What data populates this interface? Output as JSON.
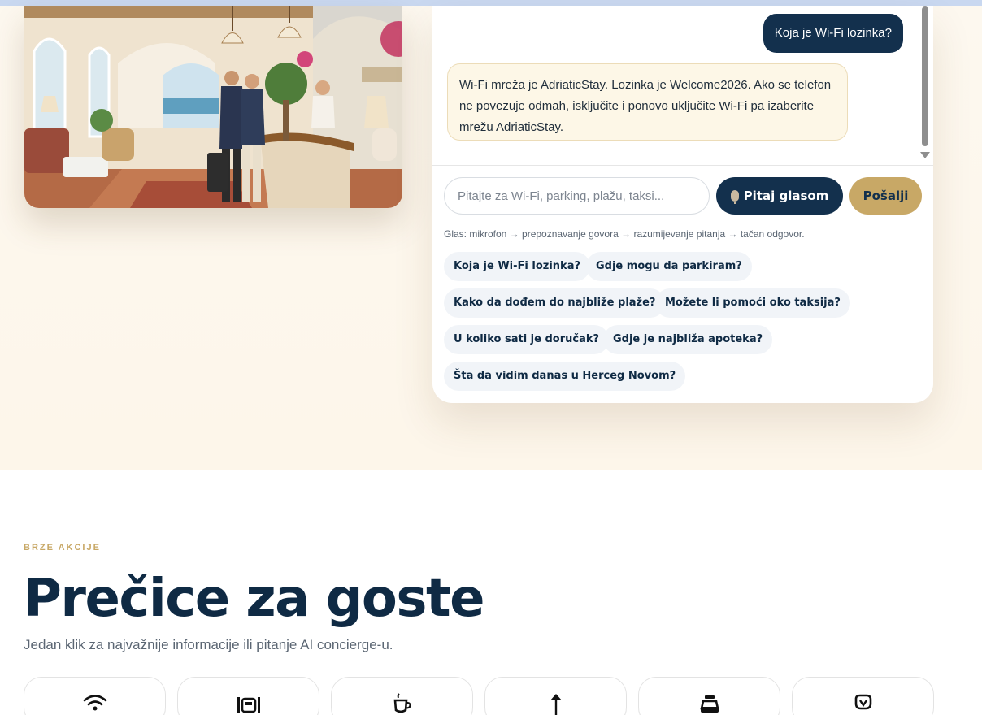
{
  "chat": {
    "user_message": "Koja je Wi-Fi lozinka?",
    "bot_message": "Wi-Fi mreža je AdriaticStay. Lozinka je Welcome2026. Ako se telefon ne povezuje odmah, isključite i ponovo uključite Wi-Fi pa izaberite mrežu AdriaticStay.",
    "input_placeholder": "Pitajte za Wi-Fi, parking, plažu, taksi...",
    "voice_button_label": "Pitaj glasom",
    "send_button_label": "Pošalji",
    "voice_hint": "Glas: mikrofon → prepoznavanje govora → razumijevanje pitanja → tačan odgovor.",
    "suggestions": [
      "Koja je Wi-Fi lozinka?",
      "Gdje mogu da parkiram?",
      "Kako da dođem do najbliže plaže?",
      "Možete li pomoći oko taksija?",
      "U koliko sati je doručak?",
      "Gdje je najbliža apoteka?",
      "Šta da vidim danas u Herceg Novom?"
    ]
  },
  "quick_actions": {
    "eyebrow": "BRZE AKCIJE",
    "title": "Prečice za goste",
    "subtitle": "Jedan klik za najvažnije informacije ili pitanje AI concierge-u.",
    "cards": [
      {
        "icon": "wifi-icon"
      },
      {
        "icon": "parking-icon"
      },
      {
        "icon": "coffee-icon"
      },
      {
        "icon": "beach-umbrella-icon"
      },
      {
        "icon": "taxi-icon"
      },
      {
        "icon": "pharmacy-icon"
      }
    ]
  },
  "colors": {
    "navy": "#13304d",
    "gold": "#c8a866",
    "cream": "#fdf8ef"
  }
}
